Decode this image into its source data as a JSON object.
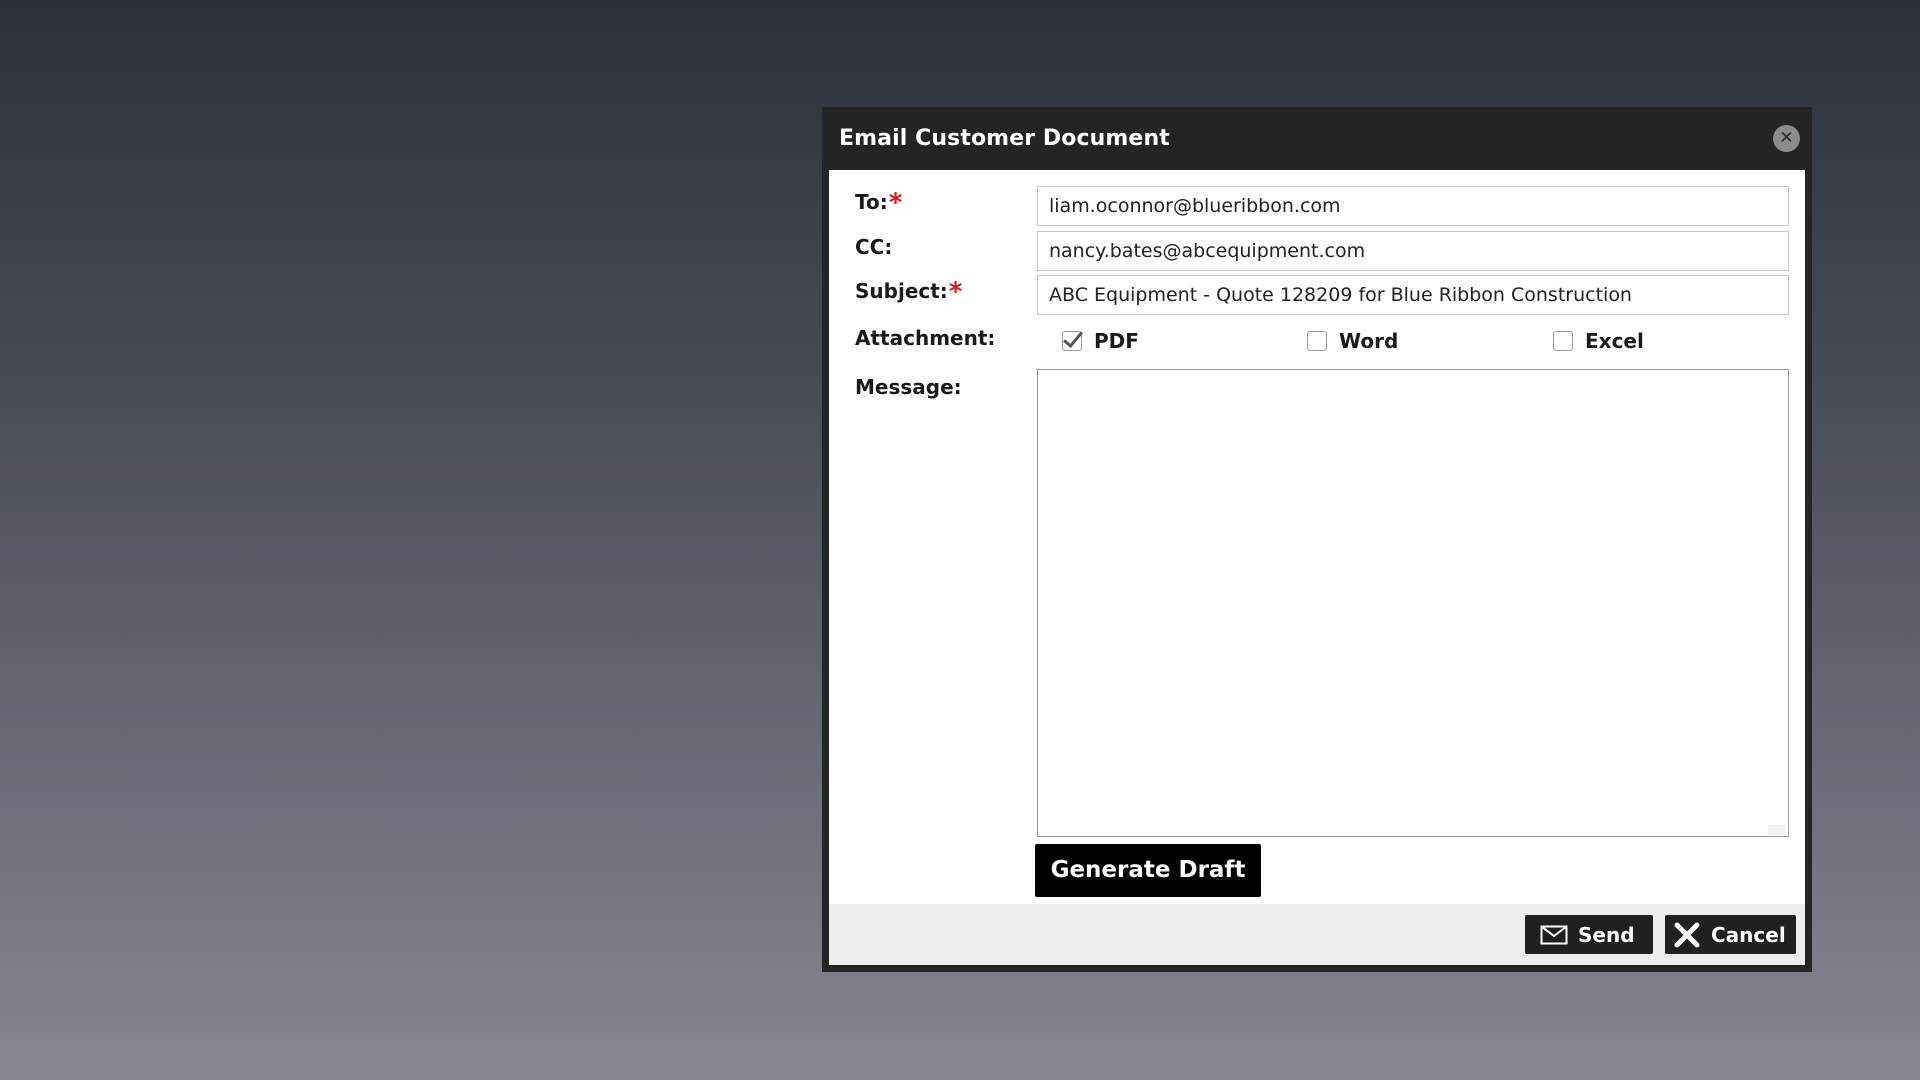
{
  "dialog": {
    "title": "Email Customer Document",
    "close_icon": "close-circle-icon"
  },
  "form": {
    "to": {
      "label": "To:",
      "required_mark": "*",
      "value": "liam.oconnor@blueribbon.com"
    },
    "cc": {
      "label": "CC:",
      "value": "nancy.bates@abcequipment.com"
    },
    "subject": {
      "label": "Subject:",
      "required_mark": "*",
      "value": "ABC Equipment - Quote 128209 for Blue Ribbon Construction"
    },
    "attachment": {
      "label": "Attachment:",
      "options": [
        {
          "label": "PDF",
          "checked": true
        },
        {
          "label": "Word",
          "checked": false
        },
        {
          "label": "Excel",
          "checked": false
        }
      ]
    },
    "message": {
      "label": "Message:",
      "value": ""
    }
  },
  "buttons": {
    "generate_draft": "Generate Draft",
    "send": "Send",
    "send_icon": "envelope-icon",
    "cancel": "Cancel",
    "cancel_icon": "x-icon"
  },
  "colors": {
    "titlebar": "#242424",
    "required": "#e01818",
    "button": "#202020",
    "footer": "#eeeeee"
  }
}
